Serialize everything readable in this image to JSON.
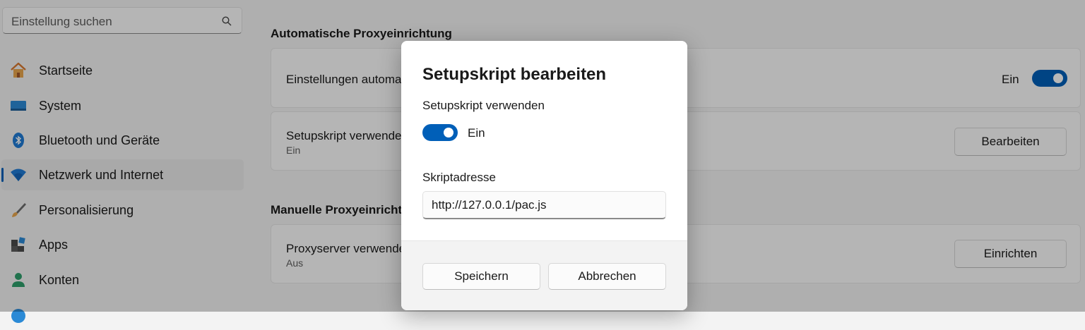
{
  "search": {
    "placeholder": "Einstellung suchen",
    "icon": "search-icon"
  },
  "sidebar": {
    "items": [
      {
        "label": "Startseite",
        "icon": "home-icon"
      },
      {
        "label": "System",
        "icon": "monitor-icon"
      },
      {
        "label": "Bluetooth und Geräte",
        "icon": "bluetooth-icon"
      },
      {
        "label": "Netzwerk und Internet",
        "icon": "wifi-icon",
        "active": true
      },
      {
        "label": "Personalisierung",
        "icon": "brush-icon"
      },
      {
        "label": "Apps",
        "icon": "apps-icon"
      },
      {
        "label": "Konten",
        "icon": "person-icon"
      }
    ]
  },
  "main": {
    "auto_section_title": "Automatische Proxyeinrichtung",
    "auto_detect": {
      "title": "Einstellungen automatisch erkennen",
      "state": "Ein",
      "on": true
    },
    "script": {
      "title": "Setupskript verwenden",
      "sub": "Ein",
      "button": "Bearbeiten"
    },
    "manual_section_title": "Manuelle Proxyeinrichtung",
    "proxy": {
      "title": "Proxyserver verwenden",
      "sub": "Aus",
      "button": "Einrichten"
    }
  },
  "dialog": {
    "title": "Setupskript bearbeiten",
    "toggle_label": "Setupskript verwenden",
    "toggle_state": "Ein",
    "toggle_on": true,
    "address_label": "Skriptadresse",
    "address_value": "http://127.0.0.1/pac.js",
    "save": "Speichern",
    "cancel": "Abbrechen"
  },
  "colors": {
    "accent": "#005fb8",
    "background": "#f3f3f3",
    "card": "#fbfbfb"
  }
}
